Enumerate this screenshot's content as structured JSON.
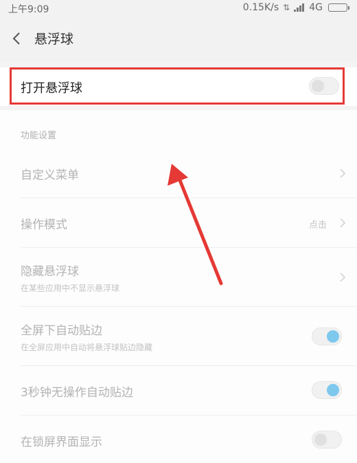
{
  "status_bar": {
    "time": "上午9:09",
    "speed": "0.15K/s",
    "network": "4G"
  },
  "header": {
    "title": "悬浮球",
    "back_icon": "chevron-left-icon"
  },
  "main_toggle": {
    "label": "打开悬浮球",
    "on": false,
    "highlight_color": "#e53935"
  },
  "section": {
    "title": "功能设置"
  },
  "rows": [
    {
      "title": "自定义菜单",
      "subtitle": "",
      "value": "",
      "control": "chevron"
    },
    {
      "title": "操作模式",
      "subtitle": "",
      "value": "点击",
      "control": "chevron"
    },
    {
      "title": "隐藏悬浮球",
      "subtitle": "在某些应用中不显示悬浮球",
      "value": "",
      "control": "chevron"
    },
    {
      "title": "全屏下自动贴边",
      "subtitle": "在全屏应用中自动将悬浮球贴边隐藏",
      "value": "",
      "control": "toggle",
      "on": true
    },
    {
      "title": "3秒钟无操作自动贴边",
      "subtitle": "",
      "value": "",
      "control": "toggle",
      "on": true
    },
    {
      "title": "在锁屏界面显示",
      "subtitle": "",
      "value": "",
      "control": "toggle",
      "on": false
    }
  ],
  "colors": {
    "accent": "#7ec8ee",
    "annotation_arrow": "#e53935"
  }
}
